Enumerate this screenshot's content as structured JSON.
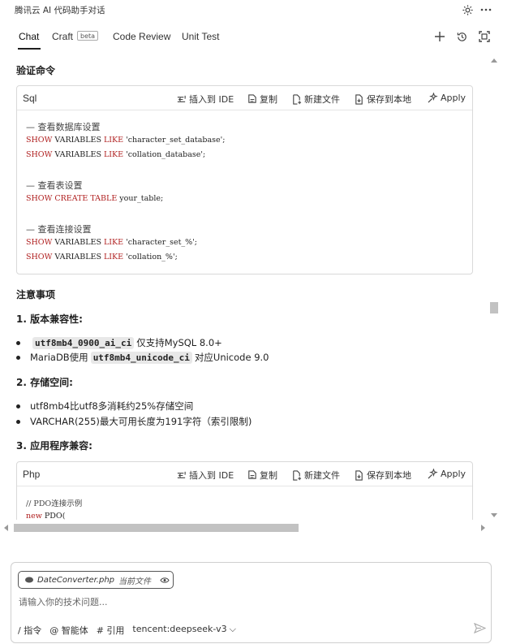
{
  "window": {
    "title": "腾讯云 AI 代码助手对话"
  },
  "tabs": [
    {
      "label": "Chat",
      "active": true
    },
    {
      "label": "Craft",
      "badge": "beta"
    },
    {
      "label": "Code Review"
    },
    {
      "label": "Unit Test"
    }
  ],
  "section_verify": "验证命令",
  "code_actions": {
    "insert": "插入到 IDE",
    "copy": "复制",
    "new_file": "新建文件",
    "save_local": "保存到本地",
    "apply": "Apply"
  },
  "sql_block": {
    "lang": "Sql",
    "comment1": "— 查看数据库设置",
    "line1_kw1": "SHOW",
    "line1_mid": " VARIABLES ",
    "line1_kw2": "LIKE",
    "line1_str": " 'character_set_database';",
    "line2_kw1": "SHOW",
    "line2_mid": " VARIABLES ",
    "line2_kw2": "LIKE",
    "line2_str": " 'collation_database';",
    "comment2": "— 查看表设置",
    "line3_kw1": "SHOW",
    "line3_kw2": " CREATE TABLE",
    "line3_rest": " your_table;",
    "comment3": "— 查看连接设置",
    "line4_kw1": "SHOW",
    "line4_mid": " VARIABLES ",
    "line4_kw2": "LIKE",
    "line4_str": " 'character_set_%';",
    "line5_kw1": "SHOW",
    "line5_mid": " VARIABLES ",
    "line5_kw2": "LIKE",
    "line5_str": " 'collation_%';"
  },
  "notes": {
    "title": "注意事项",
    "s1": "1. 版本兼容性:",
    "s1_i1_code": "utf8mb4_0900_ai_ci",
    "s1_i1_text": "仅支持MySQL 8.0+",
    "s1_i2_pre": "MariaDB使用",
    "s1_i2_code": "utf8mb4_unicode_ci",
    "s1_i2_text": "对应Unicode 9.0",
    "s2": "2. 存储空间:",
    "s2_i1": "utf8mb4比utf8多消耗约25%存储空间",
    "s2_i2": "VARCHAR(255)最大可用长度为191字符（索引限制)",
    "s3": "3. 应用程序兼容:"
  },
  "php_block": {
    "lang": "Php",
    "comment": "// PDO连接示例",
    "line1_kw": "new",
    "line1_rest": " PDO("
  },
  "input": {
    "file_name": "DateConverter.php",
    "file_tag": "当前文件",
    "placeholder": "请输入你的技术问题...",
    "cmd": "/ 指令",
    "agent": "@ 智能体",
    "ref": "# 引用",
    "model": "tencent:deepseek-v3"
  }
}
